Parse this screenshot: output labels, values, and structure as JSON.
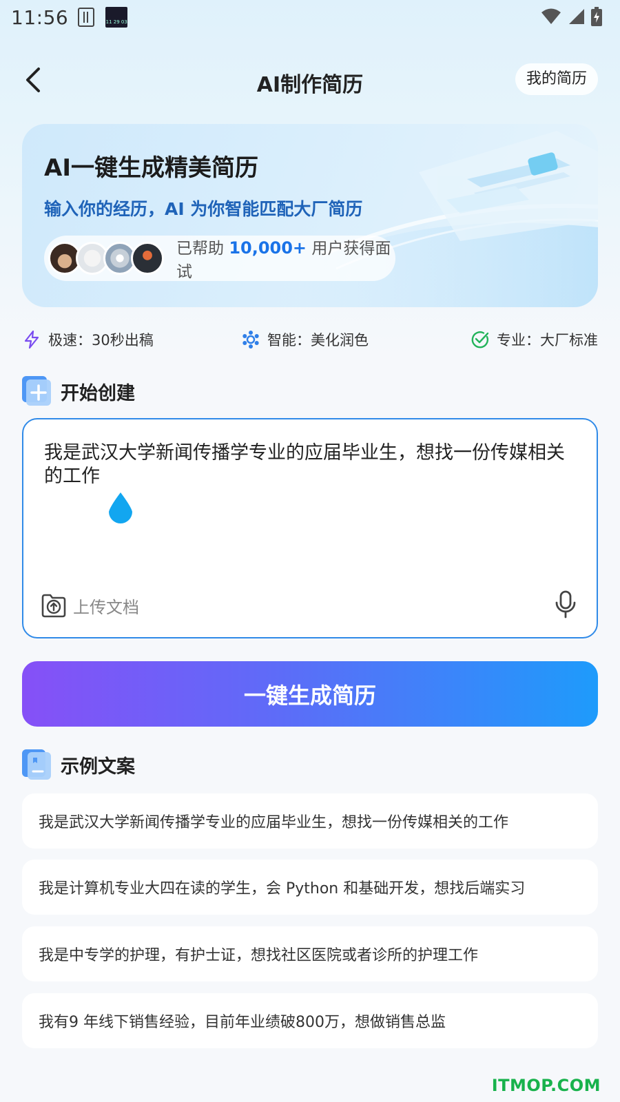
{
  "status_bar": {
    "time": "11:56",
    "clock_widget": "11 29 03",
    "icons": [
      "sim-icon",
      "clock-widget",
      "wifi-icon",
      "signal-icon",
      "battery-icon"
    ]
  },
  "header": {
    "back_icon": "chevron-left-icon",
    "title": "AI制作简历",
    "my_resume_label": "我的简历"
  },
  "banner": {
    "title": "AI一键生成精美简历",
    "subtitle": "输入你的经历，AI 为你智能匹配大厂简历",
    "users_prefix": "已帮助",
    "users_count": "10,000+",
    "users_suffix": "用户获得面试"
  },
  "features": [
    {
      "icon": "lightning-icon",
      "label": "极速：30秒出稿"
    },
    {
      "icon": "gear-icon",
      "label": "智能：美化润色"
    },
    {
      "icon": "check-circle-icon",
      "label": "专业：大厂标准"
    }
  ],
  "create_section": {
    "title": "开始创建",
    "input_value": "我是武汉大学新闻传播学专业的应届毕业生，想找一份传媒相关的工作",
    "upload_label": "上传文档",
    "mic_icon": "microphone-icon"
  },
  "generate_button": "一键生成简历",
  "examples_section": {
    "title": "示例文案",
    "items": [
      "我是武汉大学新闻传播学专业的应届毕业生，想找一份传媒相关的工作",
      "我是计算机专业大四在读的学生，会 Python 和基础开发，想找后端实习",
      "我是中专学的护理，有护士证，想找社区医院或者诊所的护理工作",
      "我有9 年线下销售经验，目前年业绩破800万，想做销售总监"
    ]
  },
  "watermark": "ITMOP.COM",
  "colors": {
    "accent_blue": "#1a73e8",
    "button_gradient_start": "#8650f7",
    "button_gradient_end": "#1e9bfb",
    "input_border": "#2f8ae8",
    "watermark_green": "#18b24c"
  }
}
